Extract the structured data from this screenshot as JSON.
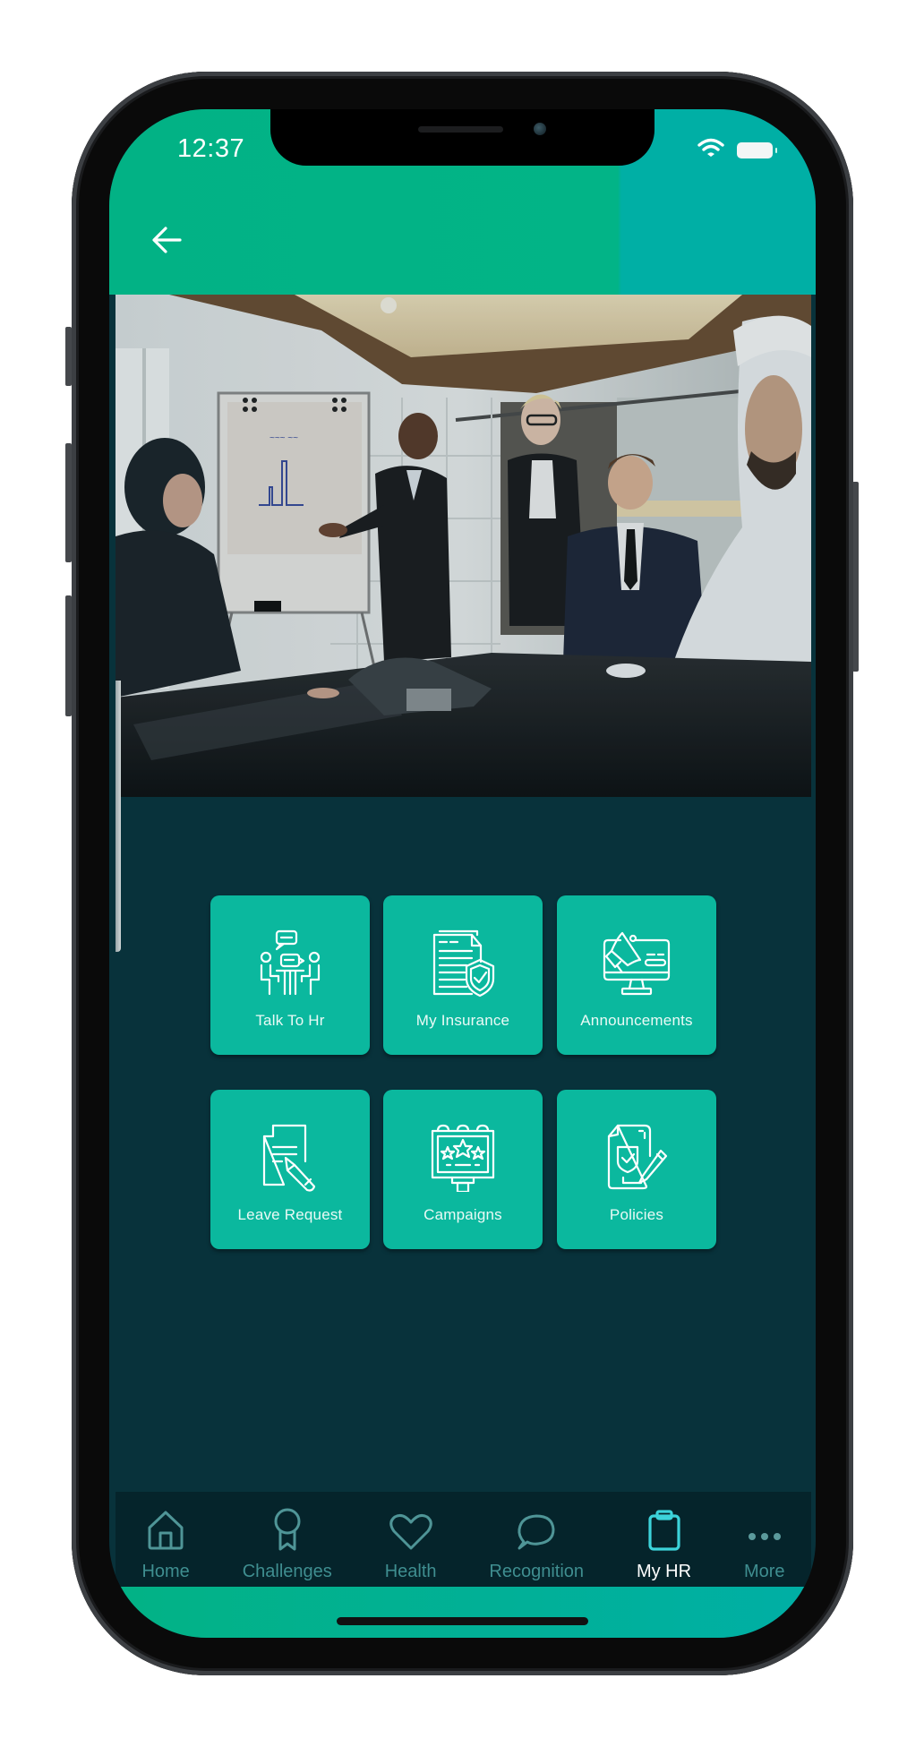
{
  "status_bar": {
    "time": "12:37",
    "wifi_icon": "wifi-icon",
    "battery_icon": "battery-icon"
  },
  "header": {
    "back_icon": "arrow-left-icon",
    "colors": {
      "green": "#02B285",
      "teal": "#00AFA5"
    }
  },
  "hero_image": {
    "description": "Business meeting in a conference room: presenter at a flip chart, colleagues seated at a glossy table"
  },
  "tiles": [
    {
      "label": "Talk To Hr",
      "icon": "talk-to-hr-icon"
    },
    {
      "label": "My Insurance",
      "icon": "insurance-document-shield-icon"
    },
    {
      "label": "Announcements",
      "icon": "megaphone-monitor-icon"
    },
    {
      "label": "Leave Request",
      "icon": "document-pencil-icon"
    },
    {
      "label": "Campaigns",
      "icon": "billboard-stars-icon"
    },
    {
      "label": "Policies",
      "icon": "policy-document-icon"
    }
  ],
  "bottom_nav": {
    "items": [
      {
        "label": "Home",
        "icon": "home-icon",
        "active": false
      },
      {
        "label": "Challenges",
        "icon": "award-ribbon-icon",
        "active": false
      },
      {
        "label": "Health",
        "icon": "heart-icon",
        "active": false
      },
      {
        "label": "Recognition",
        "icon": "chat-bubble-icon",
        "active": false
      },
      {
        "label": "My HR",
        "icon": "clipboard-icon",
        "active": true
      },
      {
        "label": "More",
        "icon": "more-dots-icon",
        "active": false
      }
    ]
  },
  "colors": {
    "body_bg": "#08323B",
    "tile_bg": "#0BB89E",
    "nav_bg": "#05242B",
    "nav_inactive": "#3F8E90",
    "nav_active_icon": "#3CD3DA",
    "nav_active_label": "#FFFFFF"
  }
}
